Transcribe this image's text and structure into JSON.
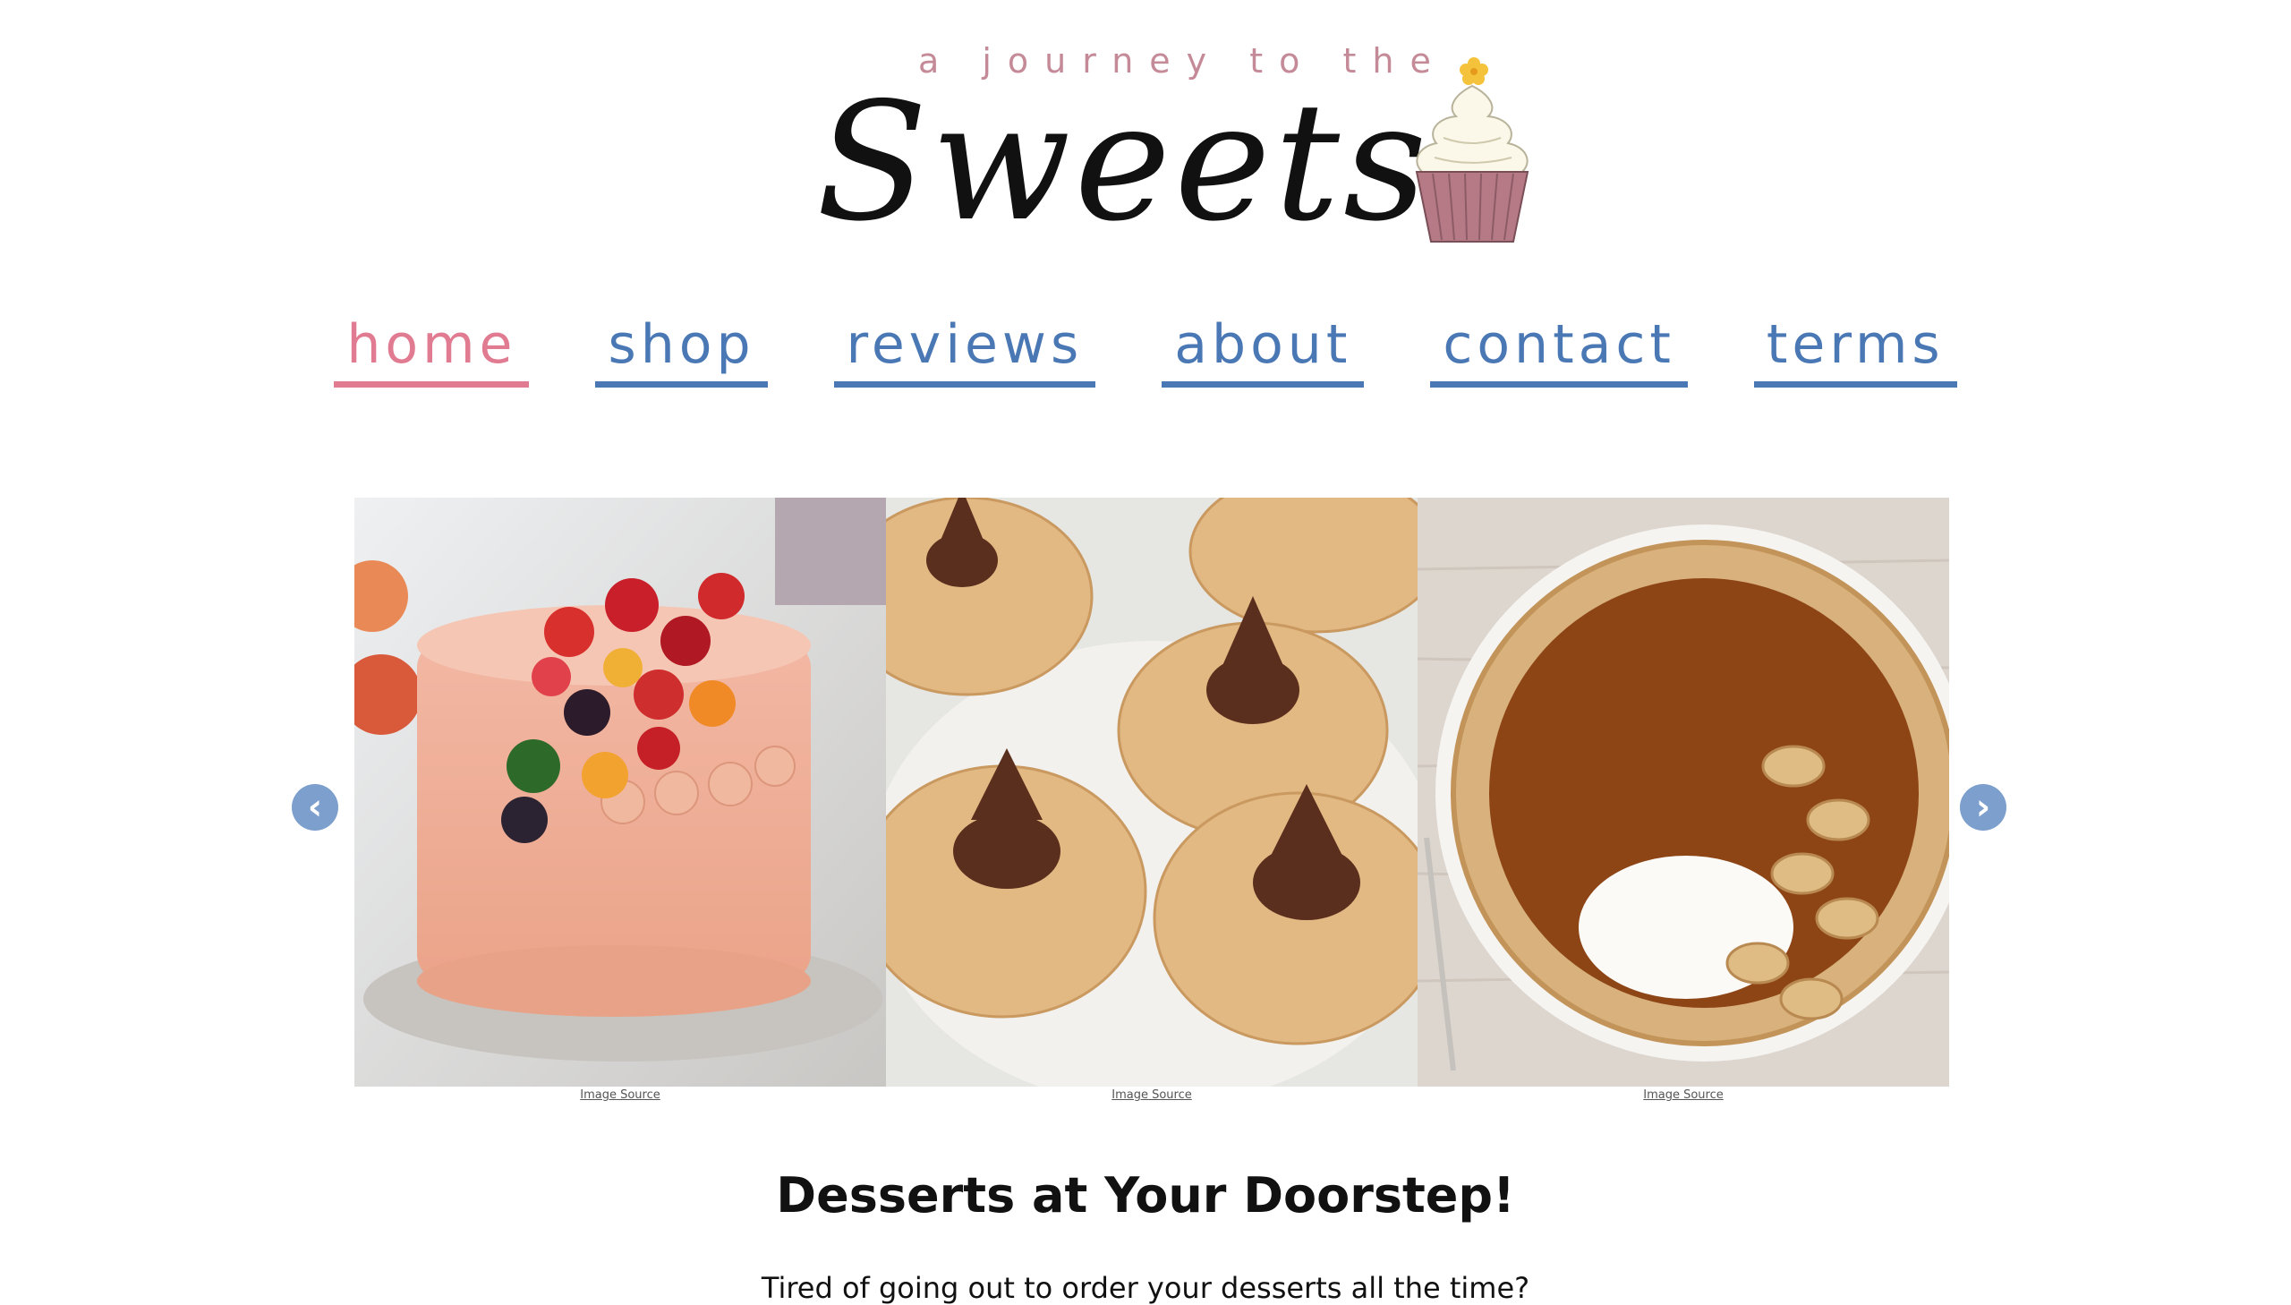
{
  "logo": {
    "tagline": "a journey to the",
    "script": "Sweets"
  },
  "nav": {
    "items": [
      {
        "label": "home",
        "active": true
      },
      {
        "label": "shop",
        "active": false
      },
      {
        "label": "reviews",
        "active": false
      },
      {
        "label": "about",
        "active": false
      },
      {
        "label": "contact",
        "active": false
      },
      {
        "label": "terms",
        "active": false
      }
    ]
  },
  "carousel": {
    "prev_icon": "chevron-left-icon",
    "next_icon": "chevron-right-icon",
    "slides": [
      {
        "caption": "Image Source",
        "subject": "fruit-topped-cake-image"
      },
      {
        "caption": "Image Source",
        "subject": "chocolate-kiss-cookies-image"
      },
      {
        "caption": "Image Source",
        "subject": "pumpkin-pie-image"
      }
    ]
  },
  "main": {
    "headline": "Desserts at Your Doorstep!",
    "intro": "Tired of going out to order your desserts all the time?"
  },
  "colors": {
    "nav_link": "#4a78b5",
    "nav_active": "#e07b91",
    "arrow": "#7d9fcd",
    "tagline": "#c58a97"
  }
}
